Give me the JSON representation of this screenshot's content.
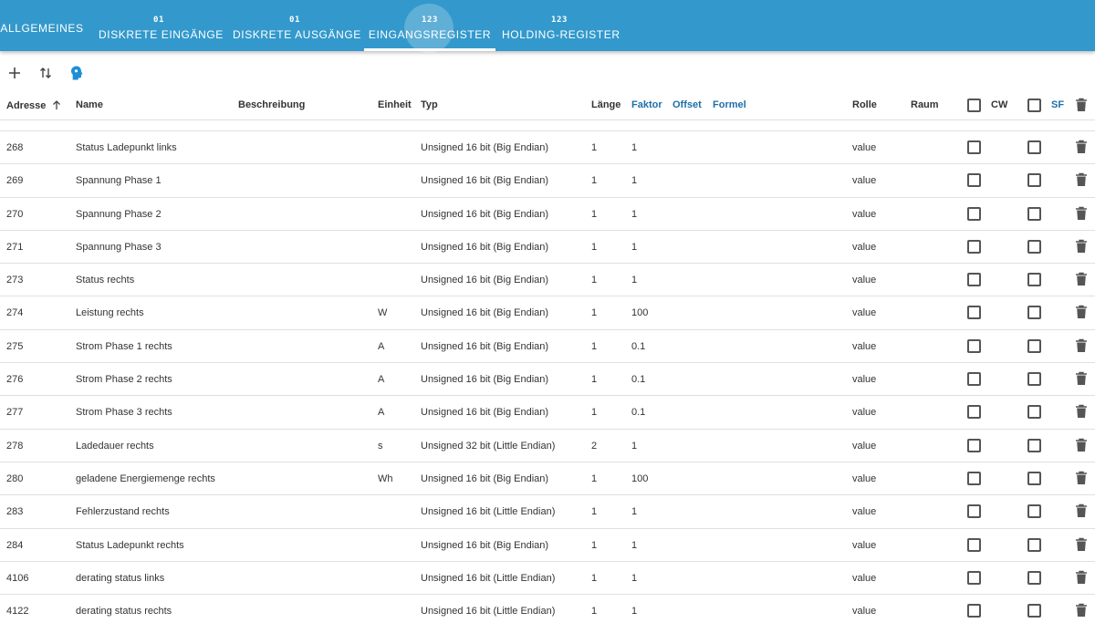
{
  "tabs": [
    {
      "top": "",
      "label": "ALLGEMEINES",
      "active": false
    },
    {
      "top": "01",
      "label": "DISKRETE EINGÄNGE",
      "active": false
    },
    {
      "top": "01",
      "label": "DISKRETE AUSGÄNGE",
      "active": false
    },
    {
      "top": "123",
      "label": "EINGANGSREGISTER",
      "active": true
    },
    {
      "top": "123",
      "label": "HOLDING-REGISTER",
      "active": false
    }
  ],
  "toolbar": {
    "add_icon": "plus-icon",
    "sort_icon": "swap-vertical-icon",
    "import_icon": "head-profile-icon",
    "accent": "#1f8ed6"
  },
  "columns": {
    "address": "Adresse",
    "name": "Name",
    "description": "Beschreibung",
    "unit": "Einheit",
    "type": "Typ",
    "length": "Länge",
    "factor": "Faktor",
    "offset": "Offset",
    "formula": "Formel",
    "role": "Rolle",
    "room": "Raum",
    "cw": "CW",
    "sf": "SF"
  },
  "colors": {
    "header_bg": "#3399cc",
    "link": "#1f6fa8"
  },
  "rows": [
    {
      "address": "268",
      "name": "Status Ladepunkt links",
      "unit": "",
      "type": "Unsigned 16 bit (Big Endian)",
      "length": "1",
      "factor": "1",
      "role": "value"
    },
    {
      "address": "269",
      "name": "Spannung Phase 1",
      "unit": "",
      "type": "Unsigned 16 bit (Big Endian)",
      "length": "1",
      "factor": "1",
      "role": "value"
    },
    {
      "address": "270",
      "name": "Spannung Phase 2",
      "unit": "",
      "type": "Unsigned 16 bit (Big Endian)",
      "length": "1",
      "factor": "1",
      "role": "value"
    },
    {
      "address": "271",
      "name": "Spannung Phase 3",
      "unit": "",
      "type": "Unsigned 16 bit (Big Endian)",
      "length": "1",
      "factor": "1",
      "role": "value"
    },
    {
      "address": "273",
      "name": "Status rechts",
      "unit": "",
      "type": "Unsigned 16 bit (Big Endian)",
      "length": "1",
      "factor": "1",
      "role": "value"
    },
    {
      "address": "274",
      "name": "Leistung rechts",
      "unit": "W",
      "type": "Unsigned 16 bit (Big Endian)",
      "length": "1",
      "factor": "100",
      "role": "value"
    },
    {
      "address": "275",
      "name": "Strom Phase 1 rechts",
      "unit": "A",
      "type": "Unsigned 16 bit (Big Endian)",
      "length": "1",
      "factor": "0.1",
      "role": "value"
    },
    {
      "address": "276",
      "name": "Strom Phase 2 rechts",
      "unit": "A",
      "type": "Unsigned 16 bit (Big Endian)",
      "length": "1",
      "factor": "0.1",
      "role": "value"
    },
    {
      "address": "277",
      "name": "Strom Phase 3 rechts",
      "unit": "A",
      "type": "Unsigned 16 bit (Big Endian)",
      "length": "1",
      "factor": "0.1",
      "role": "value"
    },
    {
      "address": "278",
      "name": "Ladedauer rechts",
      "unit": "s",
      "type": "Unsigned 32 bit (Little Endian)",
      "length": "2",
      "factor": "1",
      "role": "value"
    },
    {
      "address": "280",
      "name": "geladene Energiemenge rechts",
      "unit": "Wh",
      "type": "Unsigned 16 bit (Big Endian)",
      "length": "1",
      "factor": "100",
      "role": "value"
    },
    {
      "address": "283",
      "name": "Fehlerzustand rechts",
      "unit": "",
      "type": "Unsigned 16 bit (Little Endian)",
      "length": "1",
      "factor": "1",
      "role": "value"
    },
    {
      "address": "284",
      "name": "Status Ladepunkt rechts",
      "unit": "",
      "type": "Unsigned 16 bit (Big Endian)",
      "length": "1",
      "factor": "1",
      "role": "value"
    },
    {
      "address": "4106",
      "name": "derating status links",
      "unit": "",
      "type": "Unsigned 16 bit (Little Endian)",
      "length": "1",
      "factor": "1",
      "role": "value"
    },
    {
      "address": "4122",
      "name": "derating status rechts",
      "unit": "",
      "type": "Unsigned 16 bit (Little Endian)",
      "length": "1",
      "factor": "1",
      "role": "value"
    }
  ]
}
